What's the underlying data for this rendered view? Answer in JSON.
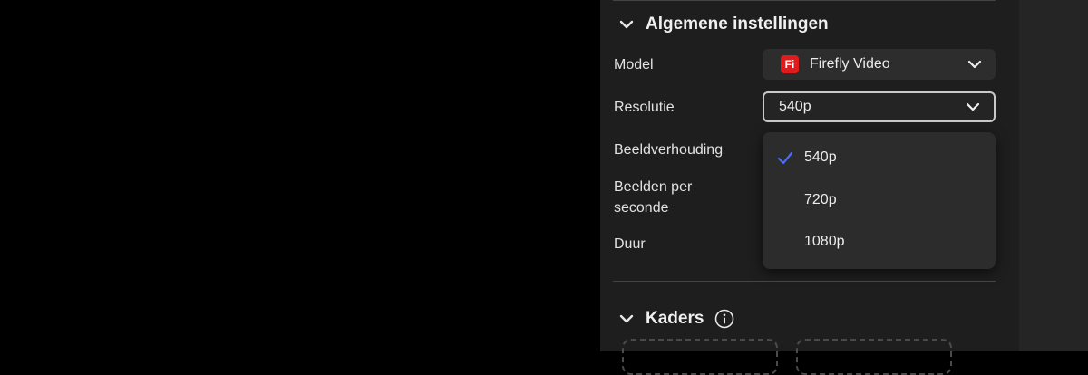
{
  "general": {
    "title": "Algemene instellingen",
    "model_label": "Model",
    "model_value": "Firefly Video",
    "model_logo": "Fi",
    "resolution_label": "Resolutie",
    "resolution_value": "540p",
    "aspect_label": "Beeldverhouding",
    "fps_label_line1": "Beelden per",
    "fps_label_line2": "seconde",
    "duration_label": "Duur"
  },
  "resolution_dropdown": {
    "options": [
      {
        "label": "540p",
        "selected": true
      },
      {
        "label": "720p",
        "selected": false
      },
      {
        "label": "1080p",
        "selected": false
      }
    ],
    "check_color": "#4b6bff"
  },
  "frames": {
    "title": "Kaders"
  },
  "icons": {
    "section_toggle": "chevron-down-icon",
    "select_toggle": "chevron-down-icon",
    "selected_mark": "checkmark-icon",
    "info": "info-icon"
  }
}
